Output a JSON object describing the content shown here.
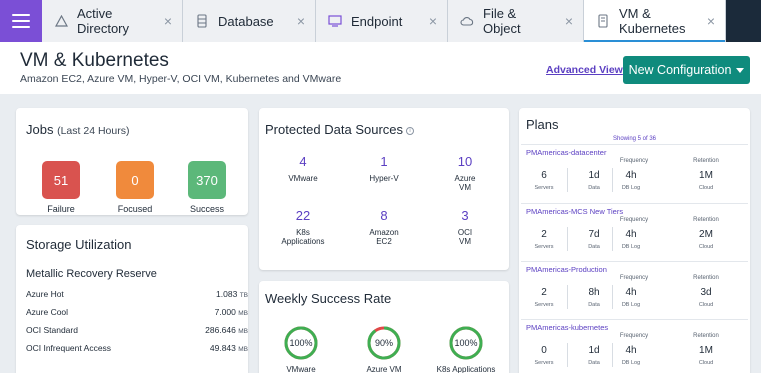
{
  "tabs": [
    {
      "label": "Active Directory",
      "icon": "triangle-icon",
      "active": false
    },
    {
      "label": "Database",
      "icon": "database-icon",
      "active": false
    },
    {
      "label": "Endpoint",
      "icon": "monitor-icon",
      "active": false
    },
    {
      "label": "File & Object",
      "icon": "cloud-icon",
      "active": false
    },
    {
      "label": "VM & Kubernetes",
      "icon": "server-icon",
      "active": true
    }
  ],
  "tab_close": "×",
  "header": {
    "title": "VM & Kubernetes",
    "subtitle": "Amazon EC2, Azure VM, Hyper-V, OCI VM, Kubernetes and VMware",
    "advanced_view": "Advanced View",
    "new_config": "New Configuration"
  },
  "jobs": {
    "title": "Jobs",
    "subtitle": "(Last 24 Hours)",
    "tiles": [
      {
        "value": "51",
        "label": "Failure",
        "color": "#d9534f"
      },
      {
        "value": "0",
        "label": "Focused",
        "color": "#f08a3c"
      },
      {
        "value": "370",
        "label": "Success",
        "color": "#5cb87a"
      }
    ]
  },
  "storage": {
    "title": "Storage Utilization",
    "section": "Metallic Recovery Reserve",
    "rows": [
      {
        "name": "Azure Hot",
        "value": "1.083",
        "unit": "TB"
      },
      {
        "name": "Azure Cool",
        "value": "7.000",
        "unit": "MB"
      },
      {
        "name": "OCI Standard",
        "value": "286.646",
        "unit": "MB"
      },
      {
        "name": "OCI Infrequent Access",
        "value": "49.843",
        "unit": "MB"
      }
    ]
  },
  "protected": {
    "title": "Protected Data Sources",
    "info": "i",
    "items": [
      {
        "value": "4",
        "label": "VMware"
      },
      {
        "value": "1",
        "label": "Hyper-V"
      },
      {
        "value": "10",
        "label": "Azure\nVM"
      },
      {
        "value": "22",
        "label": "K8s\nApplications"
      },
      {
        "value": "8",
        "label": "Amazon\nEC2"
      },
      {
        "value": "3",
        "label": "OCI\nVM"
      }
    ]
  },
  "weekly": {
    "title": "Weekly Success Rate",
    "gauges": [
      {
        "value": "100%",
        "label": "VMware",
        "fraction": 1.0
      },
      {
        "value": "90%",
        "label": "Azure VM",
        "fraction": 0.9
      },
      {
        "value": "100%",
        "label": "K8s Applications",
        "fraction": 1.0
      }
    ]
  },
  "plans": {
    "title": "Plans",
    "showing": "Showing 5 of 36",
    "frequency_label": "Frequency",
    "retention_label": "Retention",
    "servers_label": "Servers",
    "data_label": "Data",
    "dblog_label": "DB Log",
    "cloud_label": "Cloud",
    "items": [
      {
        "name": "PMAmericas-datacenter",
        "servers": "6",
        "data": "1d",
        "dblog": "4h",
        "retention": "1M"
      },
      {
        "name": "PMAmericas-MCS New Tiers",
        "servers": "2",
        "data": "7d",
        "dblog": "4h",
        "retention": "2M"
      },
      {
        "name": "PMAmericas-Production",
        "servers": "2",
        "data": "8h",
        "dblog": "4h",
        "retention": "3d"
      },
      {
        "name": "PMAmericas-kubernetes",
        "servers": "0",
        "data": "1d",
        "dblog": "4h",
        "retention": "1M"
      }
    ]
  }
}
